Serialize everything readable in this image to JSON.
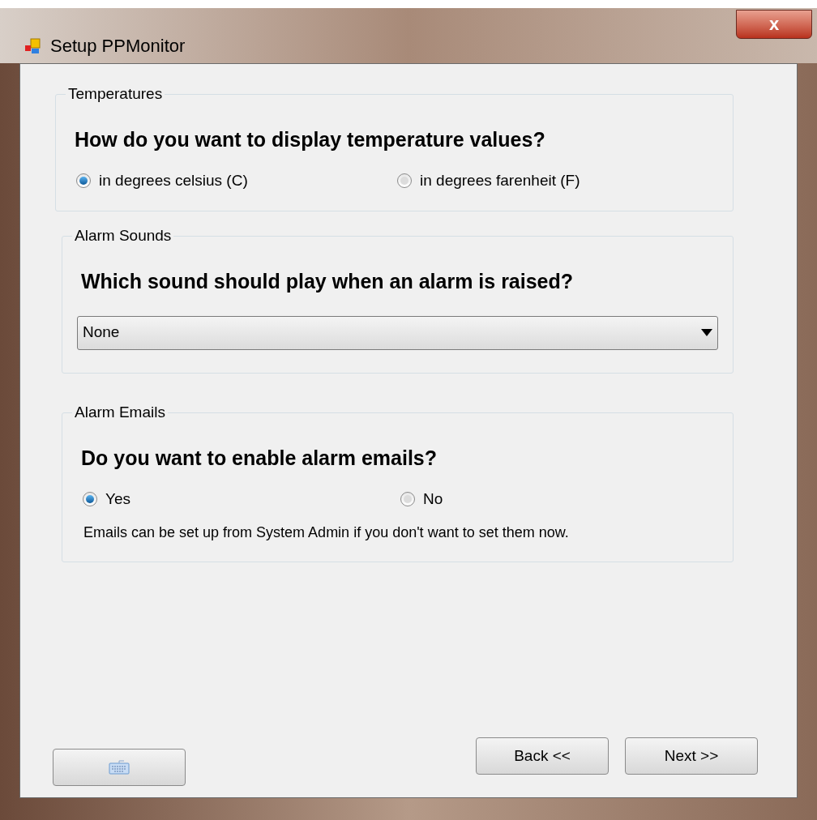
{
  "window": {
    "title": "Setup PPMonitor",
    "close_label": "x"
  },
  "groups": [
    {
      "kind": "radio",
      "legend": "Temperatures",
      "question": "How do you want to display temperature values?",
      "options": [
        {
          "label": "in degrees celsius (C)",
          "selected": true
        },
        {
          "label": "in degrees farenheit (F)",
          "selected": false
        }
      ]
    },
    {
      "kind": "dropdown",
      "legend": "Alarm Sounds",
      "question": "Which sound should play when an alarm is raised?",
      "value": "None"
    },
    {
      "kind": "radio",
      "legend": "Alarm Emails",
      "question": "Do you want to enable alarm emails?",
      "options": [
        {
          "label": "Yes",
          "selected": true
        },
        {
          "label": "No",
          "selected": false
        }
      ],
      "note": "Emails can be set up from System Admin if you don't want to set them now."
    }
  ],
  "buttons": [
    "Back <<",
    "Next >>"
  ]
}
